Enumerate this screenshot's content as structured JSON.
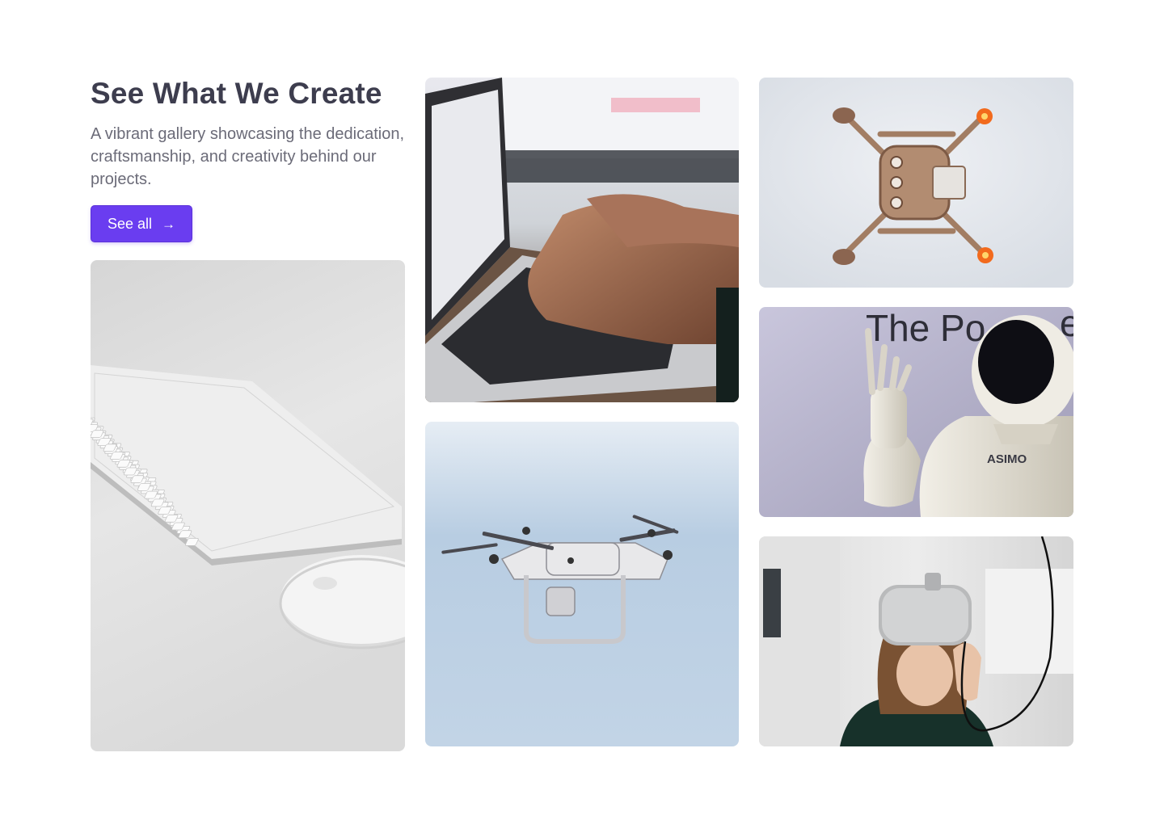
{
  "section": {
    "title": "See What We Create",
    "description": "A vibrant gallery showcasing the dedication, craftsmanship, and creativity behind our projects.",
    "button_label": "See all",
    "button_icon": "arrow-right-icon",
    "accent_color": "#6a3df0"
  },
  "gallery": {
    "images": [
      {
        "subject": "keyboard-and-mouse"
      },
      {
        "subject": "hands-typing-on-laptop"
      },
      {
        "subject": "drone-in-flight"
      },
      {
        "subject": "drone-top-view"
      },
      {
        "subject": "asimo-robot",
        "visible_text": [
          "The Po",
          "e",
          "ASIMO"
        ]
      },
      {
        "subject": "person-wearing-vr-headset"
      }
    ]
  }
}
